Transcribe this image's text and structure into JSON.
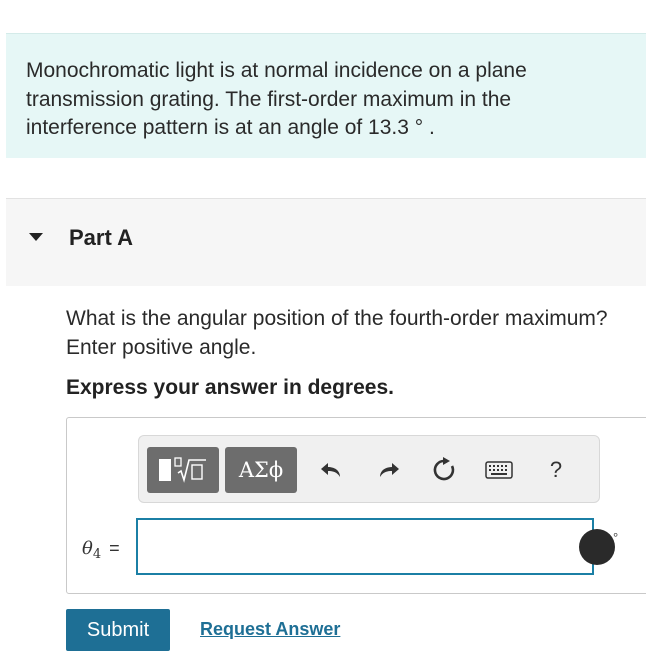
{
  "problem": {
    "text": "Monochromatic light is at normal incidence on a plane transmission grating. The first-order maximum in the interference pattern is at an angle of 13.3 ° ."
  },
  "part": {
    "title": "Part A",
    "question": "What is the angular position of the fourth-order maximum? Enter positive angle.",
    "instruction": "Express your answer in degrees."
  },
  "toolbar": {
    "greek_label": "ΑΣϕ",
    "help_label": "?"
  },
  "answer": {
    "variable": "θ",
    "subscript": "4",
    "equals": "=",
    "value": "",
    "unit": "°"
  },
  "actions": {
    "submit_label": "Submit",
    "request_label": "Request Answer"
  },
  "colors": {
    "accent": "#1e6f95",
    "problem_bg": "#e6f7f6"
  }
}
